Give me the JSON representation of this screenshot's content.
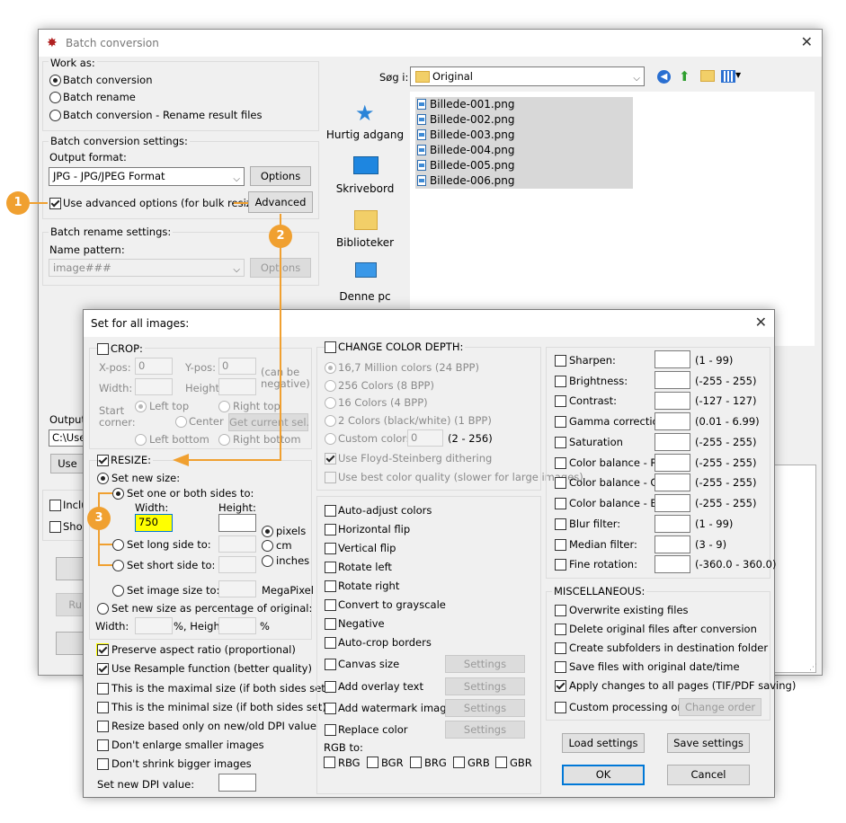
{
  "main": {
    "title": "Batch conversion",
    "work_as_caption": "Work as:",
    "work_as_options": [
      "Batch conversion",
      "Batch rename",
      "Batch conversion - Rename result files"
    ],
    "conv_settings_caption": "Batch conversion settings:",
    "output_format_label": "Output format:",
    "output_format_value": "JPG - JPG/JPEG Format",
    "options_btn": "Options",
    "advanced_check_label": "Use advanced options (for bulk resize...)",
    "advanced_btn": "Advanced",
    "rename_caption": "Batch rename settings:",
    "name_pattern_label": "Name pattern:",
    "name_pattern_value": "image###",
    "output_folder_label": "Output f",
    "output_folder_value": "C:\\User",
    "use_btn": "Use",
    "include_label": "Inclu",
    "show_label": "Show",
    "run_btn": "Ru",
    "look_in_label": "Søg i:",
    "folder_value": "Original",
    "nav_items": [
      "Hurtig adgang",
      "Skrivebord",
      "Biblioteker",
      "Denne pc"
    ],
    "files": [
      "Billede-001.png",
      "Billede-002.png",
      "Billede-003.png",
      "Billede-004.png",
      "Billede-005.png",
      "Billede-006.png"
    ]
  },
  "badges": [
    "1",
    "2",
    "3"
  ],
  "dialog": {
    "title": "Set for all images:",
    "crop": {
      "label": "CROP:",
      "xpos": "X-pos:",
      "xpos_val": "0",
      "ypos": "Y-pos:",
      "ypos_val": "0",
      "can_be_negative": "(can be negative)",
      "width": "Width:",
      "height": "Height:",
      "start_corner": "Start corner:",
      "left_top": "Left top",
      "right_top": "Right top",
      "center": "Center",
      "get_current": "Get current sel.",
      "left_bottom": "Left bottom",
      "right_bottom": "Right bottom"
    },
    "resize": {
      "label": "RESIZE:",
      "set_new_size": "Set new size:",
      "one_or_both": "Set one or both sides to:",
      "width": "Width:",
      "height": "Height:",
      "width_val": "750",
      "pixels": "pixels",
      "cm": "cm",
      "inches": "inches",
      "long_side": "Set long side to:",
      "short_side": "Set short side to:",
      "image_size": "Set image size to:",
      "megapixel": "MegaPixel",
      "percentage": "Set new size as percentage of original:",
      "pct_width": "Width:",
      "pct_height": "%, Height:",
      "pct_end": "%"
    },
    "resize_options": [
      {
        "label": "Preserve aspect ratio (proportional)",
        "checked": true,
        "highlight": true
      },
      {
        "label": "Use Resample function (better quality)",
        "checked": true,
        "highlight": false
      },
      {
        "label": "This is the maximal size (if both sides set)",
        "checked": false,
        "highlight": false
      },
      {
        "label": "This is the minimal size (if both sides set)",
        "checked": false,
        "highlight": false
      },
      {
        "label": "Resize based only on new/old DPI value",
        "checked": false,
        "highlight": false
      },
      {
        "label": "Don't enlarge smaller images",
        "checked": false,
        "highlight": false
      },
      {
        "label": "Don't shrink bigger images",
        "checked": false,
        "highlight": false
      }
    ],
    "dpi_label": "Set new DPI value:",
    "color_depth": {
      "label": "CHANGE COLOR DEPTH:",
      "options": [
        "16,7 Million colors (24 BPP)",
        "256 Colors (8 BPP)",
        "16 Colors (4 BPP)",
        "2 Colors (black/white) (1 BPP)"
      ],
      "custom": "Custom colors:",
      "custom_val": "0",
      "custom_range": "(2 - 256)",
      "floyd": "Use Floyd-Steinberg dithering",
      "best_quality": "Use best color quality (slower for large images)"
    },
    "middle_options": [
      "Auto-adjust colors",
      "Horizontal flip",
      "Vertical flip",
      "Rotate left",
      "Rotate right",
      "Convert to grayscale",
      "Negative",
      "Auto-crop borders"
    ],
    "setting_options": [
      "Canvas size",
      "Add overlay text",
      "Add watermark image",
      "Replace color"
    ],
    "settings_btn": "Settings",
    "rgb_label": "RGB to:",
    "rgb_options": [
      "RBG",
      "BGR",
      "BRG",
      "GRB",
      "GBR"
    ],
    "filters": [
      {
        "label": "Sharpen:",
        "range": "(1  -  99)"
      },
      {
        "label": "Brightness:",
        "range": "(-255  -  255)"
      },
      {
        "label": "Contrast:",
        "range": "(-127  -  127)"
      },
      {
        "label": "Gamma correction:",
        "range": "(0.01  -  6.99)"
      },
      {
        "label": "Saturation",
        "range": "(-255  -  255)"
      },
      {
        "label": "Color balance - R:",
        "range": "(-255  -  255)"
      },
      {
        "label": "Color balance - G:",
        "range": "(-255  -  255)"
      },
      {
        "label": "Color balance - B:",
        "range": "(-255  -  255)"
      },
      {
        "label": "Blur filter:",
        "range": "(1  -  99)"
      },
      {
        "label": "Median filter:",
        "range": "(3  -  9)"
      },
      {
        "label": "Fine rotation:",
        "range": "(-360.0  -  360.0)"
      }
    ],
    "misc_label": "MISCELLANEOUS:",
    "misc_options": [
      {
        "label": "Overwrite existing files",
        "checked": false
      },
      {
        "label": "Delete original files after conversion",
        "checked": false
      },
      {
        "label": "Create subfolders in destination folder",
        "checked": false
      },
      {
        "label": "Save files with original date/time",
        "checked": false
      },
      {
        "label": "Apply changes to all pages (TIF/PDF saving)",
        "checked": true
      }
    ],
    "custom_order": "Custom processing order",
    "change_order_btn": "Change order",
    "load_btn": "Load settings",
    "save_btn": "Save settings",
    "ok_btn": "OK",
    "cancel_btn": "Cancel"
  },
  "colors": {
    "accent": "#f0a030",
    "highlight": "#ffff00",
    "focus": "#0078d7"
  }
}
